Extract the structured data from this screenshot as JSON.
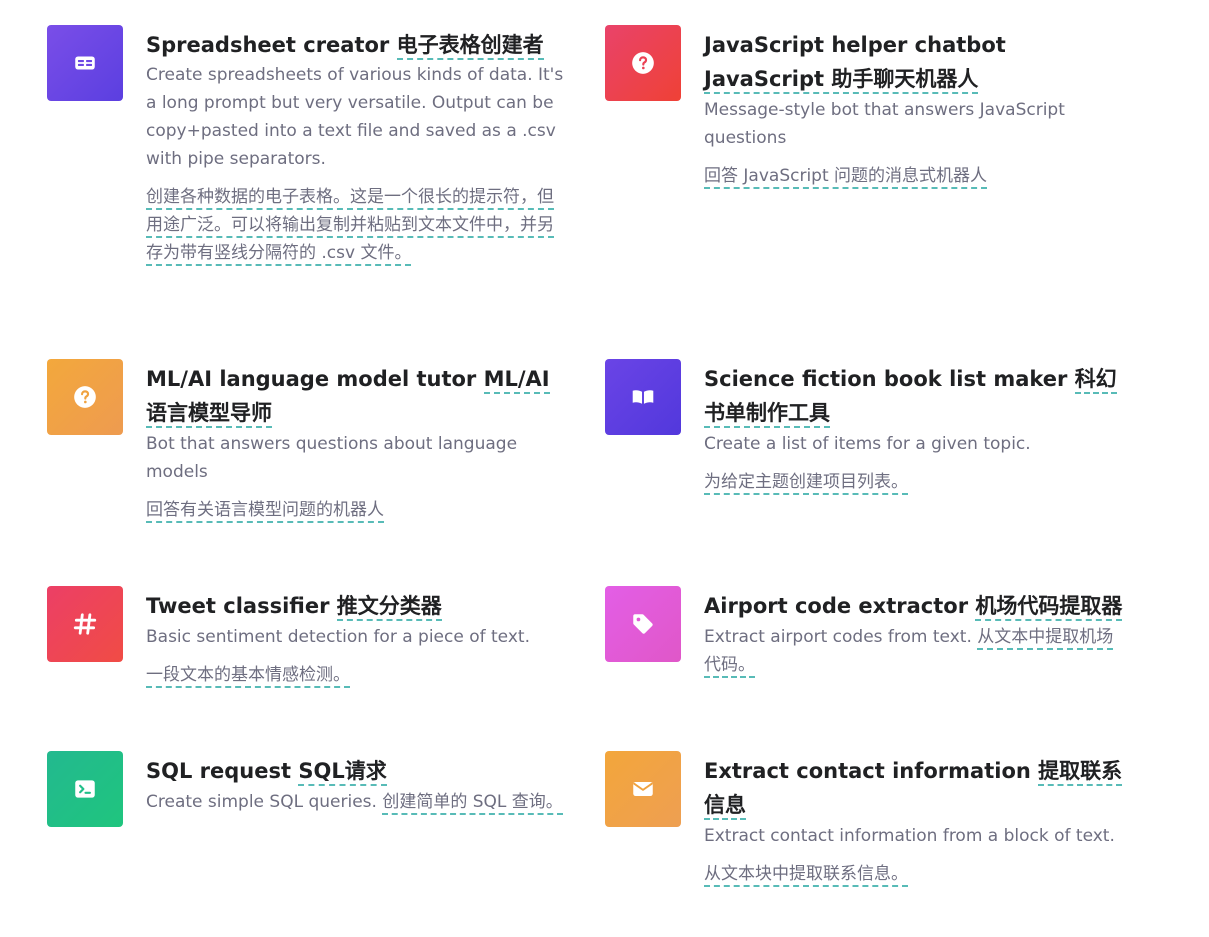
{
  "colors": {
    "purple": "#6c47e4",
    "red": "#eb4154",
    "orange": "#f0a23f",
    "indigo": "#5b3fe0",
    "pink": "#e357d8",
    "green": "#22c08a",
    "underline_teal": "#58bbb7",
    "title_text": "#202123",
    "desc_text": "#6e6e80"
  },
  "cards": [
    {
      "icon": "spreadsheet-icon",
      "title_en": "Spreadsheet creator",
      "title_zh": "电子表格创建者",
      "desc_en": "Create spreadsheets of various kinds of data. It's a long prompt but very versatile. Output can be copy+pasted into a text file and saved as a .csv with pipe separators.",
      "desc_zh": "创建各种数据的电子表格。这是一个很长的提示符，但用途广泛。可以将输出复制并粘贴到文本文件中，并另存为带有竖线分隔符的 .csv 文件。"
    },
    {
      "icon": "question-icon",
      "title_en": "JavaScript helper chatbot",
      "title_zh": "JavaScript 助手聊天机器人",
      "desc_en": "Message-style bot that answers JavaScript questions",
      "desc_zh": "回答 JavaScript 问题的消息式机器人"
    },
    {
      "icon": "question-icon",
      "title_en": "ML/AI language model tutor",
      "title_zh": "ML/AI语言模型导师",
      "desc_en": "Bot that answers questions about language models",
      "desc_zh": "回答有关语言模型问题的机器人"
    },
    {
      "icon": "book-icon",
      "title_en": "Science fiction book list maker",
      "title_zh": "科幻书单制作工具",
      "desc_en": "Create a list of items for a given topic.",
      "desc_zh": "为给定主题创建项目列表。"
    },
    {
      "icon": "hashtag-icon",
      "title_en": "Tweet classifier",
      "title_zh": "推文分类器",
      "desc_en": "Basic sentiment detection for a piece of text.",
      "desc_zh": "一段文本的基本情感检测。"
    },
    {
      "icon": "tag-icon",
      "title_en": "Airport code extractor",
      "title_zh": "机场代码提取器",
      "desc_en": "Extract airport codes from text.",
      "desc_zh_inline": "从文本中提取机场代码。"
    },
    {
      "icon": "terminal-icon",
      "title_en": "SQL request",
      "title_zh": "SQL请求",
      "desc_en": "Create simple SQL queries.",
      "desc_zh_inline": "创建简单的 SQL 查询。"
    },
    {
      "icon": "mail-icon",
      "title_en": "Extract contact information",
      "title_zh": "提取联系信息",
      "desc_en": "Extract contact information from a block of text.",
      "desc_zh": "从文本块中提取联系信息。"
    }
  ]
}
